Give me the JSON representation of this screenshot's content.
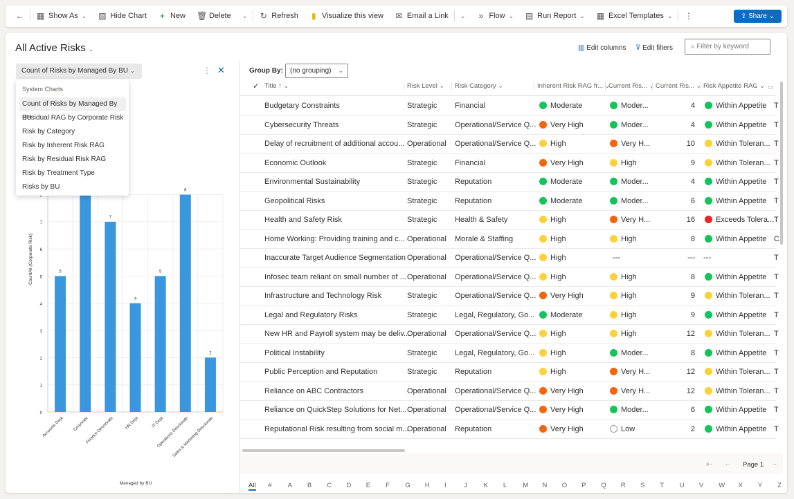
{
  "toolbar": {
    "items": [
      {
        "icon": "back-arrow-icon",
        "glyph": "←",
        "label": ""
      },
      {
        "icon": "show-as-icon",
        "glyph": "▦",
        "label": "Show As",
        "chev": true
      },
      {
        "icon": "chart-icon",
        "glyph": "▨",
        "label": "Hide Chart"
      },
      {
        "icon": "plus-icon",
        "glyph": "+",
        "label": "New"
      },
      {
        "icon": "trash-icon",
        "glyph": "🗑",
        "label": "Delete"
      },
      {
        "icon": "chevron-down-icon",
        "glyph": "",
        "label": "",
        "chev": true
      },
      {
        "icon": "refresh-icon",
        "glyph": "↻",
        "label": "Refresh"
      },
      {
        "icon": "power-bi-icon",
        "glyph": "▮",
        "label": "Visualize this view"
      },
      {
        "icon": "email-icon",
        "glyph": "✉",
        "label": "Email a Link"
      },
      {
        "icon": "chevron-down-icon",
        "glyph": "",
        "label": "",
        "chev": true
      },
      {
        "icon": "flow-icon",
        "glyph": "»",
        "label": "Flow",
        "chev": true
      },
      {
        "icon": "report-icon",
        "glyph": "▤",
        "label": "Run Report",
        "chev": true
      },
      {
        "icon": "excel-icon",
        "glyph": "▦",
        "label": "Excel Templates",
        "chev": true
      },
      {
        "icon": "more-icon",
        "glyph": "⋮",
        "label": ""
      }
    ],
    "share_label": "Share"
  },
  "view": {
    "title": "All Active Risks",
    "edit_columns": "Edit columns",
    "edit_filters": "Edit filters",
    "filter_placeholder": "Filter by keyword"
  },
  "chart_panel": {
    "selected": "Count of Risks by Managed By BU",
    "menu_header": "System Charts",
    "menu_items": [
      "Count of Risks by Managed By BU",
      "Residual RAG by Corporate Risk",
      "Risk by Category",
      "Risk by Inherent Risk RAG",
      "Risk by Residual Risk RAG",
      "Risk by Treatment Type",
      "Risks by BU"
    ]
  },
  "chart_data": {
    "type": "bar",
    "categories": [
      "Accounts Dept",
      "Corporate",
      "Finance Directorate",
      "HR Dept",
      "IT Dept",
      "Operations Directorate",
      "Sales & Marketing Directorate"
    ],
    "values": [
      5,
      8,
      7,
      4,
      5,
      8,
      2
    ],
    "xlabel": "Managed by BU",
    "ylabel": "CountAll (Corporate Risk)",
    "ylim": [
      0,
      8
    ],
    "yticks": [
      0,
      1,
      2,
      3,
      4,
      5,
      6,
      7,
      8
    ],
    "grid": true,
    "color": "#3a96dd"
  },
  "grid": {
    "group_by_label": "Group By:",
    "group_by_value": "(no grouping)",
    "columns": [
      "Title ↑",
      "Risk Level",
      "Risk Category",
      "Inherent Risk RAG fr...",
      "Current Ris...",
      "Current Ris...",
      "Risk Appetite RAG"
    ],
    "rows": [
      [
        "Budgetary Constraints",
        "Strategic",
        "Financial",
        "Moderate",
        "g",
        "Moder...",
        "g",
        "4",
        "Within Appetite",
        "g",
        "T"
      ],
      [
        "Cybersecurity Threats",
        "Strategic",
        "Operational/Service Q...",
        "Very High",
        "o",
        "Moder...",
        "g",
        "4",
        "Within Appetite",
        "g",
        "T"
      ],
      [
        "Delay of recruitment of additional accou...",
        "Operational",
        "Operational/Service Q...",
        "High",
        "y",
        "Very H...",
        "o",
        "10",
        "Within Toleran...",
        "y",
        "T"
      ],
      [
        "Economic Outlook",
        "Strategic",
        "Financial",
        "Very High",
        "o",
        "High",
        "y",
        "9",
        "Within Toleran...",
        "y",
        "T"
      ],
      [
        "Environmental Sustainability",
        "Strategic",
        "Reputation",
        "Moderate",
        "g",
        "Moder...",
        "g",
        "4",
        "Within Appetite",
        "g",
        "T"
      ],
      [
        "Geopolitical Risks",
        "Strategic",
        "Reputation",
        "Moderate",
        "g",
        "Moder...",
        "g",
        "6",
        "Within Appetite",
        "g",
        "T"
      ],
      [
        "Health and Safety Risk",
        "Strategic",
        "Health & Safety",
        "High",
        "y",
        "Very H...",
        "o",
        "16",
        "Exceeds Tolera...",
        "r",
        "T"
      ],
      [
        "Home Working: Providing training and c...",
        "Operational",
        "Morale & Staffing",
        "High",
        "y",
        "High",
        "y",
        "8",
        "Within Appetite",
        "g",
        "C"
      ],
      [
        "Inaccurate Target Audience Segmentation",
        "Operational",
        "Operational/Service Q...",
        "High",
        "y",
        "---",
        "n",
        "---",
        "---",
        "n",
        "T"
      ],
      [
        "Infosec team reliant on small number of ...",
        "Operational",
        "Operational/Service Q...",
        "High",
        "y",
        "High",
        "y",
        "8",
        "Within Appetite",
        "g",
        "T"
      ],
      [
        "Infrastructure and Technology Risk",
        "Strategic",
        "Operational/Service Q...",
        "Very High",
        "o",
        "High",
        "y",
        "9",
        "Within Toleran...",
        "y",
        "T"
      ],
      [
        "Legal and Regulatory Risks",
        "Strategic",
        "Legal, Regulatory, Go...",
        "Moderate",
        "g",
        "High",
        "y",
        "9",
        "Within Appetite",
        "g",
        "T"
      ],
      [
        "New HR and Payroll system may be deliv...",
        "Operational",
        "Operational/Service Q...",
        "High",
        "y",
        "High",
        "y",
        "12",
        "Within Toleran...",
        "y",
        "T"
      ],
      [
        "Political Instability",
        "Strategic",
        "Legal, Regulatory, Go...",
        "High",
        "y",
        "Moder...",
        "g",
        "8",
        "Within Appetite",
        "g",
        "T"
      ],
      [
        "Public Perception and Reputation",
        "Strategic",
        "Reputation",
        "High",
        "y",
        "Very H...",
        "o",
        "12",
        "Within Toleran...",
        "y",
        "T"
      ],
      [
        "Reliance on ABC Contractors",
        "Operational",
        "Operational/Service Q...",
        "Very High",
        "o",
        "Very H...",
        "o",
        "12",
        "Within Toleran...",
        "y",
        "T"
      ],
      [
        "Reliance on QuickStep Solutions for Net...",
        "Operational",
        "Operational/Service Q...",
        "Very High",
        "o",
        "Moder...",
        "g",
        "6",
        "Within Appetite",
        "g",
        "T"
      ],
      [
        "Reputational Risk resulting from social m...",
        "Operational",
        "Reputation",
        "Very High",
        "o",
        "Low",
        "e",
        "2",
        "Within Appetite",
        "g",
        "T"
      ]
    ]
  },
  "rag_colors": {
    "g": "#13c45a",
    "o": "#f7630c",
    "y": "#fdd13a",
    "r": "#e8262a"
  },
  "pager": {
    "label": "Page 1"
  },
  "alphabet": [
    "All",
    "#",
    "A",
    "B",
    "C",
    "D",
    "E",
    "F",
    "G",
    "H",
    "I",
    "J",
    "K",
    "L",
    "M",
    "N",
    "O",
    "P",
    "Q",
    "R",
    "S",
    "T",
    "U",
    "V",
    "W",
    "X",
    "Y",
    "Z"
  ]
}
